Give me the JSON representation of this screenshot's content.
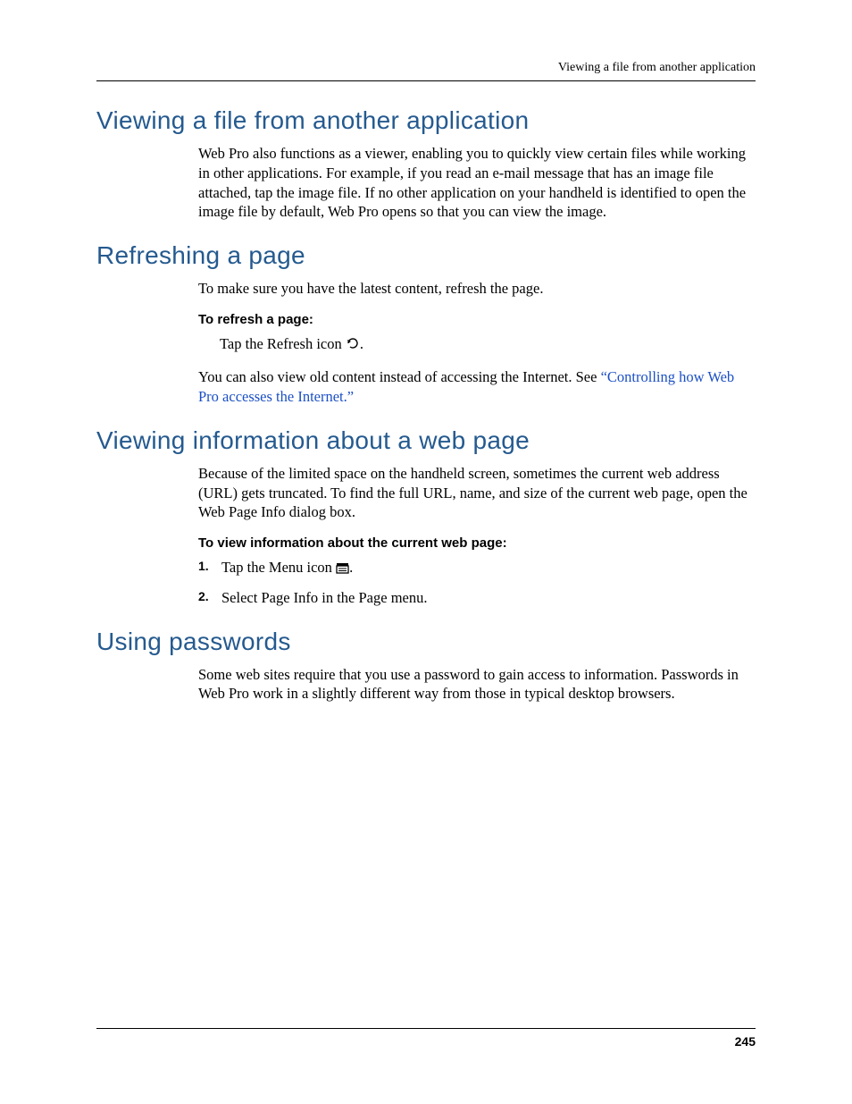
{
  "running_head": "Viewing a file from another application",
  "page_number": "245",
  "sections": {
    "s1": {
      "title": "Viewing a file from another application",
      "p1": "Web Pro also functions as a viewer, enabling you to quickly view certain files while working in other applications. For example, if you read an e-mail message that has an image file attached, tap the image file. If no other application on your handheld is identified to open the image file by default, Web Pro opens so that you can view the image."
    },
    "s2": {
      "title": "Refreshing a page",
      "p1": "To make sure you have the latest content, refresh the page.",
      "proc_title": "To refresh a page:",
      "step_prefix": "Tap the Refresh icon ",
      "step_suffix": ".",
      "p2_prefix": "You can also view old content instead of accessing the Internet. See ",
      "p2_link": "“Controlling how Web Pro accesses the Internet.”"
    },
    "s3": {
      "title": "Viewing information about a web page",
      "p1": "Because of the limited space on the handheld screen, sometimes the current web address (URL) gets truncated. To find the full URL, name, and size of the current web page, open the Web Page Info dialog box.",
      "proc_title": "To view information about the current web page:",
      "step1_prefix": "Tap the Menu icon ",
      "step1_suffix": ".",
      "step2": "Select Page Info in the Page menu."
    },
    "s4": {
      "title": "Using passwords",
      "p1": "Some web sites require that you use a password to gain access to information. Passwords in Web Pro work in a slightly different way from those in typical desktop browsers."
    }
  }
}
